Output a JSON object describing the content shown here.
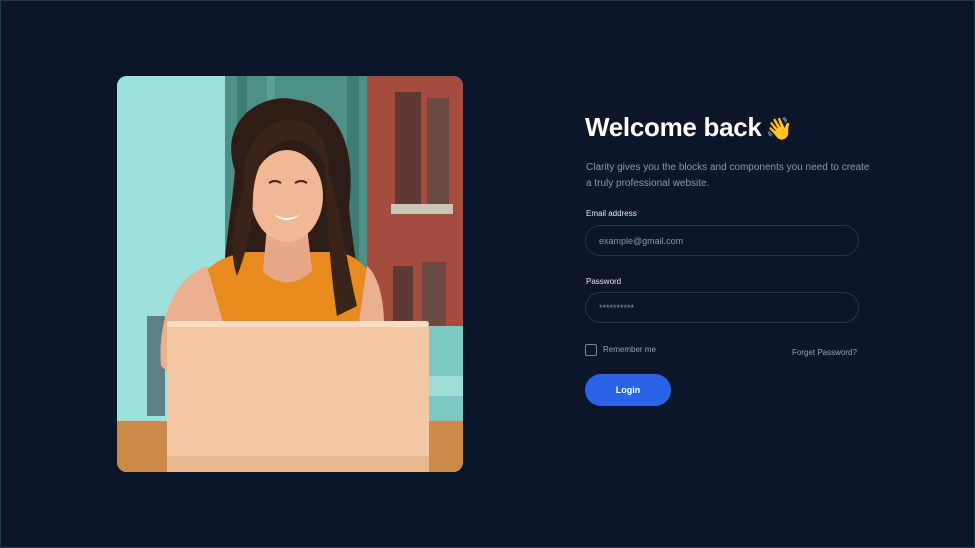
{
  "login": {
    "title": "Welcome back",
    "title_emoji": "👋",
    "subtitle": "Clarity gives you the blocks and components you need to create a truly professional website.",
    "email_label": "Email address",
    "email_placeholder": "example@gmail.com",
    "password_label": "Password",
    "password_value": "**********",
    "remember_label": "Remember me",
    "remember_checked": false,
    "forgot_label": "Forget Password?",
    "login_label": "Login"
  },
  "colors": {
    "background": "#0d1528",
    "accent": "#2b63e6",
    "muted_text": "#8e97ab",
    "field_border": "#2a3449"
  }
}
